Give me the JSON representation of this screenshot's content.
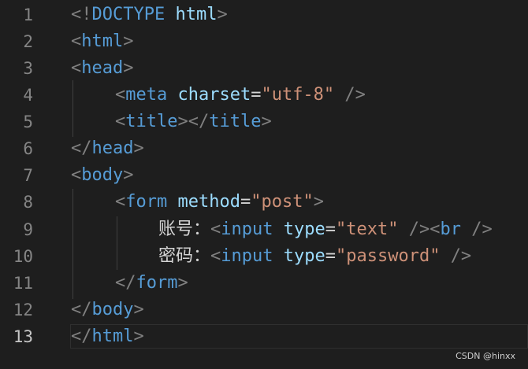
{
  "editor": {
    "lines": [
      {
        "num": "1",
        "parts": [
          [
            "t-bracket",
            "<!"
          ],
          [
            "t-tag",
            "DOCTYPE"
          ],
          [
            "t-text",
            " "
          ],
          [
            "t-attr",
            "html"
          ],
          [
            "t-bracket",
            ">"
          ]
        ]
      },
      {
        "num": "2",
        "parts": [
          [
            "t-bracket",
            "<"
          ],
          [
            "t-tag",
            "html"
          ],
          [
            "t-bracket",
            ">"
          ]
        ]
      },
      {
        "num": "3",
        "parts": [
          [
            "t-bracket",
            "<"
          ],
          [
            "t-tag",
            "head"
          ],
          [
            "t-bracket",
            ">"
          ]
        ]
      },
      {
        "num": "4",
        "parts": [
          [
            "t-bracket",
            "<"
          ],
          [
            "t-tag",
            "meta"
          ],
          [
            "t-text",
            " "
          ],
          [
            "t-attr",
            "charset"
          ],
          [
            "t-eq",
            "="
          ],
          [
            "t-str",
            "\"utf-8\""
          ],
          [
            "t-text",
            " "
          ],
          [
            "t-bracket",
            "/>"
          ]
        ]
      },
      {
        "num": "5",
        "parts": [
          [
            "t-bracket",
            "<"
          ],
          [
            "t-tag",
            "title"
          ],
          [
            "t-bracket",
            "></"
          ],
          [
            "t-tag",
            "title"
          ],
          [
            "t-bracket",
            ">"
          ]
        ]
      },
      {
        "num": "6",
        "parts": [
          [
            "t-bracket",
            "</"
          ],
          [
            "t-tag",
            "head"
          ],
          [
            "t-bracket",
            ">"
          ]
        ]
      },
      {
        "num": "7",
        "parts": [
          [
            "t-bracket",
            "<"
          ],
          [
            "t-tag",
            "body"
          ],
          [
            "t-bracket",
            ">"
          ]
        ]
      },
      {
        "num": "8",
        "parts": [
          [
            "t-bracket",
            "<"
          ],
          [
            "t-tag",
            "form"
          ],
          [
            "t-text",
            " "
          ],
          [
            "t-attr",
            "method"
          ],
          [
            "t-eq",
            "="
          ],
          [
            "t-str",
            "\"post\""
          ],
          [
            "t-bracket",
            ">"
          ]
        ]
      },
      {
        "num": "9",
        "parts": [
          [
            "t-text",
            "账号："
          ],
          [
            "t-bracket",
            "<"
          ],
          [
            "t-tag",
            "input"
          ],
          [
            "t-text",
            " "
          ],
          [
            "t-attr",
            "type"
          ],
          [
            "t-eq",
            "="
          ],
          [
            "t-str",
            "\"text\""
          ],
          [
            "t-text",
            " "
          ],
          [
            "t-bracket",
            "/><"
          ],
          [
            "t-tag",
            "br"
          ],
          [
            "t-text",
            " "
          ],
          [
            "t-bracket",
            "/>"
          ]
        ]
      },
      {
        "num": "10",
        "parts": [
          [
            "t-text",
            "密码："
          ],
          [
            "t-bracket",
            "<"
          ],
          [
            "t-tag",
            "input"
          ],
          [
            "t-text",
            " "
          ],
          [
            "t-attr",
            "type"
          ],
          [
            "t-eq",
            "="
          ],
          [
            "t-str",
            "\"password\""
          ],
          [
            "t-text",
            " "
          ],
          [
            "t-bracket",
            "/>"
          ]
        ]
      },
      {
        "num": "11",
        "parts": [
          [
            "t-bracket",
            "</"
          ],
          [
            "t-tag",
            "form"
          ],
          [
            "t-bracket",
            ">"
          ]
        ]
      },
      {
        "num": "12",
        "parts": [
          [
            "t-bracket",
            "</"
          ],
          [
            "t-tag",
            "body"
          ],
          [
            "t-bracket",
            ">"
          ]
        ]
      },
      {
        "num": "13",
        "parts": [
          [
            "t-bracket",
            "</"
          ],
          [
            "t-tag",
            "html"
          ],
          [
            "t-bracket",
            ">"
          ]
        ]
      }
    ],
    "active_line": "13"
  },
  "watermark": "CSDN @hinxx"
}
